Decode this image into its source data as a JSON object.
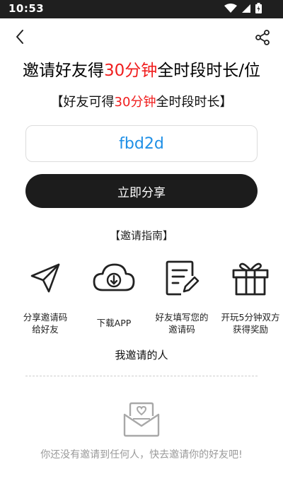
{
  "status_bar": {
    "time": "10:53"
  },
  "header": {
    "headline_prefix": "邀请好友得",
    "headline_highlight": "30分钟",
    "headline_suffix": "全时段时长/位",
    "subline_prefix": "【好友可得",
    "subline_highlight": "30分钟",
    "subline_suffix": "全时段时长】",
    "highlight_color": "#f01e1e"
  },
  "invite_code": "fbd2d",
  "share_button_label": "立即分享",
  "guide": {
    "title": "【邀请指南】",
    "steps": [
      {
        "icon": "paper-plane-icon",
        "line1": "分享邀请码",
        "line2": "给好友"
      },
      {
        "icon": "cloud-download-icon",
        "line1": "下载APP",
        "line2": ""
      },
      {
        "icon": "edit-document-icon",
        "line1": "好友填写您的",
        "line2": "邀请码"
      },
      {
        "icon": "gift-icon",
        "line1": "开玩5分钟双方",
        "line2": "获得奖励"
      }
    ]
  },
  "invited_section": {
    "title": "我邀请的人",
    "empty_icon": "mail-heart-icon",
    "empty_text": "你还没有邀请到任何人，快去邀请你的好友吧!"
  }
}
